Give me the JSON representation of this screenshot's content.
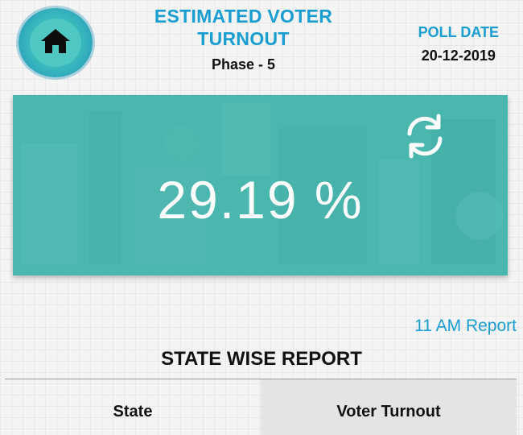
{
  "header": {
    "title": "ESTIMATED VOTER TURNOUT",
    "phase": "Phase - 5",
    "poll_date_label": "POLL DATE",
    "poll_date": "20-12-2019"
  },
  "icons": {
    "home": "home-icon",
    "refresh": "refresh-icon"
  },
  "turnout": {
    "value": "29.19 %"
  },
  "report": {
    "time_label": "11 AM Report"
  },
  "state_report": {
    "title": "STATE WISE REPORT",
    "columns": [
      "State",
      "Voter Turnout"
    ]
  },
  "colors": {
    "accent_blue": "#1a9dd0",
    "card_teal": "#4ab7ae"
  }
}
